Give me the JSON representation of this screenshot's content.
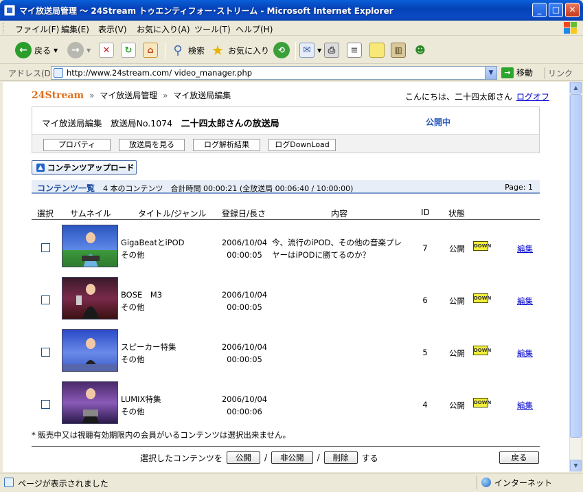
{
  "window": {
    "title": "マイ放送局管理 ～ 24Stream トゥエンティフォー･ストリーム - Microsoft Internet Explorer"
  },
  "menu": [
    "ファイル(F)",
    "編集(E)",
    "表示(V)",
    "お気に入り(A)",
    "ツール(T)",
    "ヘルプ(H)"
  ],
  "toolbar": {
    "back": "戻る",
    "search": "検索",
    "favorites": "お気に入り"
  },
  "address": {
    "label": "アドレス(D)",
    "url": "http://www.24stream.com/ video_manager.php",
    "go": "移動",
    "links": "リンク"
  },
  "breadcrumb": {
    "logo": "24Stream",
    "sep": "»",
    "item1": "マイ放送局管理",
    "item2": "マイ放送局編集"
  },
  "greeting": {
    "text": "こんにちは、二十四太郎さん",
    "logoff": "ログオフ"
  },
  "station": {
    "label": "マイ放送局編集　放送局No.1074",
    "name": "二十四太郎さんの放送局",
    "status": "公開中",
    "buttons": [
      "プロパティ",
      "放送局を見る",
      "ログ解析結果",
      "ログDownLoad"
    ]
  },
  "upload_label": "コンテンツアップロード",
  "list": {
    "title": "コンテンツ一覧",
    "info": "4 本のコンテンツ　合計時間 00:00:21 (全放送局 00:06:40 / 10:00:00)",
    "page": "Page: 1"
  },
  "columns": [
    "選択",
    "サムネイル",
    "タイトル/ジャンル",
    "登録日/長さ",
    "内容",
    "ID",
    "状態"
  ],
  "rows": [
    {
      "title": "GigaBeatとiPOD",
      "genre": "その他",
      "date": "2006/10/04",
      "length": "00:00:05",
      "desc": "今、流行のiPOD、その他の音楽プレヤーはiPODに勝てるのか？",
      "id": "7",
      "status": "公開",
      "badge": "DOWN",
      "edit": "編集"
    },
    {
      "title": "BOSE　M3",
      "genre": "その他",
      "date": "2006/10/04",
      "length": "00:00:05",
      "desc": "",
      "id": "6",
      "status": "公開",
      "badge": "DOWN",
      "edit": "編集"
    },
    {
      "title": "スピーカー特集",
      "genre": "その他",
      "date": "2006/10/04",
      "length": "00:00:05",
      "desc": "",
      "id": "5",
      "status": "公開",
      "badge": "DOWN",
      "edit": "編集"
    },
    {
      "title": "LUMIX特集",
      "genre": "その他",
      "date": "2006/10/04",
      "length": "00:00:06",
      "desc": "",
      "id": "4",
      "status": "公開",
      "badge": "DOWN",
      "edit": "編集"
    }
  ],
  "note": "* 販売中又は視聴有効期限内の会員がいるコンテンツは選択出来ません。",
  "actions": {
    "prefix": "選択したコンテンツを",
    "publish": "公開",
    "slash": "/",
    "unpublish": "非公開",
    "delete": "削除",
    "suffix": "する",
    "back": "戻る"
  },
  "statusbar": {
    "message": "ページが表示されました",
    "zone": "インターネット"
  }
}
